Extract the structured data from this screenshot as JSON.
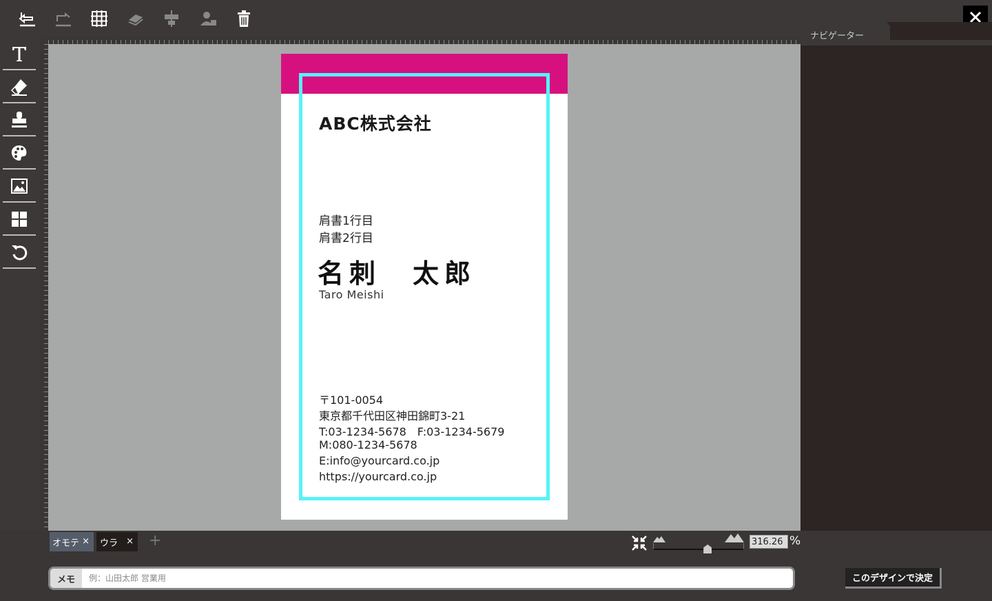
{
  "toolbar": {
    "icons": [
      "undo-icon",
      "redo-icon",
      "grid-icon",
      "layer-send-back-icon",
      "align-icon",
      "user-layer-icon",
      "trash-icon"
    ],
    "close_icon": "close-icon"
  },
  "tools": {
    "icons": [
      "text-icon",
      "eraser-icon",
      "stamp-icon",
      "palette-icon",
      "image-icon",
      "template-icon",
      "reset-icon"
    ]
  },
  "navigator": {
    "label": "ナビゲーター"
  },
  "card": {
    "company": "ABC株式会社",
    "title_line1": "肩書1行目",
    "title_line2": "肩書2行目",
    "name": "名刺　太郎",
    "romaji": "Taro Meishi",
    "address_lines": [
      "〒101-0054",
      "東京都千代田区神田錦町3-21",
      "T:03-1234-5678　F:03-1234-5679",
      "M:080-1234-5678",
      "E:info@yourcard.co.jp",
      "https://yourcard.co.jp"
    ],
    "band_color": "#d6117f",
    "safe_frame_color": "#55f4f5"
  },
  "pages": {
    "tabs": [
      {
        "label": "オモテ",
        "close": "×"
      },
      {
        "label": "ウラ",
        "close": "×"
      }
    ],
    "add": "+"
  },
  "zoom": {
    "value": "316.26",
    "unit": "%",
    "level_fraction": 0.6
  },
  "memo": {
    "label": "メモ",
    "placeholder": "例：山田太郎 営業用",
    "value": ""
  },
  "decide_button": {
    "label": "このデザインで決定"
  }
}
